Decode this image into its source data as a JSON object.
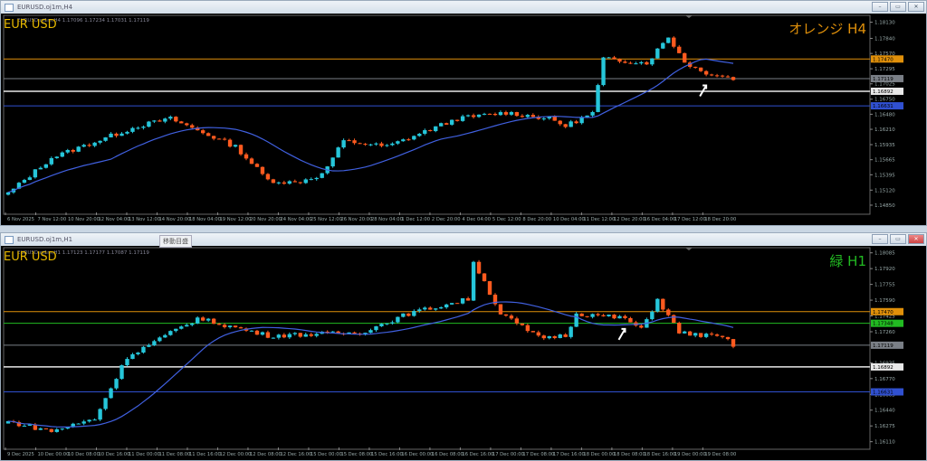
{
  "colors": {
    "bull": "#26c6da",
    "bear": "#ff5a1f",
    "ma": "#4060e0",
    "orange": "#e0900a",
    "gray": "#7a7f86",
    "white": "#e8e8e8",
    "blue": "#3050d0",
    "green": "#22bb22",
    "symbol": "#e6b800"
  },
  "windows": [
    {
      "title": "EURUSD.oj1m,H4",
      "ohlc": "EURUSD.oj1m,H4  1.17096 1.17234 1.17031 1.17119",
      "symbol_label": "EUR USD",
      "tag": "オレンジ H4",
      "tag_color": "#e0900a",
      "price_ticks": [
        "1.18130",
        "1.17840",
        "1.17570",
        "1.17295",
        "1.17025",
        "1.16750",
        "1.16480",
        "1.16210",
        "1.15935",
        "1.15665",
        "1.15395",
        "1.15120",
        "1.14850"
      ],
      "levels": [
        {
          "price": "1.17470",
          "color": "#e0900a"
        },
        {
          "price": "1.17119",
          "color": "#7a7f86"
        },
        {
          "price": "1.16892",
          "color": "#e8e8e8"
        },
        {
          "price": "1.16631",
          "color": "#3050d0"
        }
      ],
      "time_ticks": [
        "6 Nov 2025",
        "7 Nov 12:00",
        "10 Nov 20:00",
        "12 Nov 04:00",
        "13 Nov 12:00",
        "14 Nov 20:00",
        "18 Nov 04:00",
        "19 Nov 12:00",
        "20 Nov 20:00",
        "24 Nov 04:00",
        "25 Nov 12:00",
        "26 Nov 20:00",
        "28 Nov 04:00",
        "1 Dec 12:00",
        "2 Dec 20:00",
        "4 Dec 04:00",
        "5 Dec 12:00",
        "8 Dec 20:00",
        "10 Dec 04:00",
        "11 Dec 12:00",
        "12 Dec 20:00",
        "16 Dec 04:00",
        "17 Dec 12:00",
        "18 Dec 20:00"
      ],
      "chart_data": {
        "type": "candlestick",
        "ylim": [
          1.1472,
          1.1822
        ],
        "bars": 135,
        "ma_period": 20,
        "close_path": [
          [
            0,
            1.1506
          ],
          [
            8,
            1.157
          ],
          [
            24,
            1.1627
          ],
          [
            30,
            1.164
          ],
          [
            42,
            1.159
          ],
          [
            48,
            1.153
          ],
          [
            53,
            1.1525
          ],
          [
            58,
            1.154
          ],
          [
            62,
            1.16
          ],
          [
            70,
            1.159
          ],
          [
            83,
            1.164
          ],
          [
            92,
            1.1651
          ],
          [
            100,
            1.164
          ],
          [
            103,
            1.1627
          ],
          [
            108,
            1.165
          ],
          [
            110,
            1.1747
          ],
          [
            118,
            1.174
          ],
          [
            122,
            1.1787
          ],
          [
            125,
            1.1742
          ],
          [
            128,
            1.1725
          ],
          [
            134,
            1.1712
          ]
        ],
        "arrow_bar": 129
      }
    },
    {
      "title": "EURUSD.oj1m,H1",
      "ohlc": "EURUSD.oj1m,H1  1.17123 1.17177 1.17087 1.17119",
      "symbol_label": "EUR USD",
      "tag": "緑 H1",
      "tag_color": "#22bb22",
      "price_ticks": [
        "1.18085",
        "1.17920",
        "1.17755",
        "1.17590",
        "1.17425",
        "1.17260",
        "1.16935",
        "1.16770",
        "1.16605",
        "1.16440",
        "1.16275",
        "1.16110"
      ],
      "levels": [
        {
          "price": "1.17470",
          "color": "#e0900a"
        },
        {
          "price": "1.17348",
          "color": "#22bb22"
        },
        {
          "price": "1.17119",
          "color": "#7a7f86"
        },
        {
          "price": "1.16892",
          "color": "#e8e8e8"
        },
        {
          "price": "1.16631",
          "color": "#3050d0"
        }
      ],
      "time_ticks": [
        "9 Dec 2025",
        "10 Dec 00:00",
        "10 Dec 08:00",
        "10 Dec 16:00",
        "11 Dec 00:00",
        "11 Dec 08:00",
        "11 Dec 16:00",
        "12 Dec 00:00",
        "12 Dec 08:00",
        "12 Dec 16:00",
        "15 Dec 00:00",
        "15 Dec 08:00",
        "15 Dec 16:00",
        "16 Dec 00:00",
        "16 Dec 08:00",
        "16 Dec 16:00",
        "17 Dec 00:00",
        "17 Dec 08:00",
        "17 Dec 16:00",
        "18 Dec 00:00",
        "18 Dec 08:00",
        "18 Dec 16:00",
        "19 Dec 00:00",
        "19 Dec 08:00"
      ],
      "chart_data": {
        "type": "candlestick",
        "ylim": [
          1.1605,
          1.1812
        ],
        "bars": 135,
        "ma_period": 20,
        "close_path": [
          [
            0,
            1.1632
          ],
          [
            8,
            1.1622
          ],
          [
            16,
            1.1635
          ],
          [
            22,
            1.17
          ],
          [
            35,
            1.174
          ],
          [
            48,
            1.1722
          ],
          [
            65,
            1.1725
          ],
          [
            74,
            1.1745
          ],
          [
            85,
            1.176
          ],
          [
            86,
            1.18
          ],
          [
            91,
            1.1745
          ],
          [
            98,
            1.172
          ],
          [
            103,
            1.1722
          ],
          [
            105,
            1.1745
          ],
          [
            114,
            1.174
          ],
          [
            117,
            1.1728
          ],
          [
            120,
            1.176
          ],
          [
            124,
            1.1725
          ],
          [
            132,
            1.172
          ],
          [
            134,
            1.1712
          ]
        ],
        "arrow_bar": 114
      }
    }
  ],
  "tooltip": "移動目盛"
}
